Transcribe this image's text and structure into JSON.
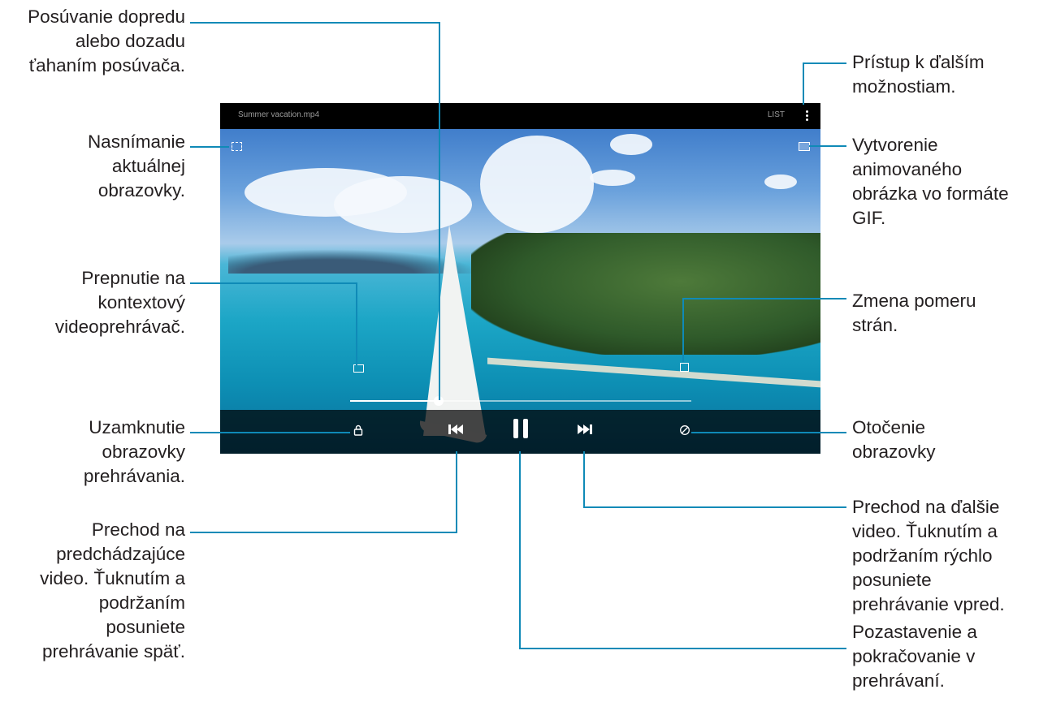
{
  "video": {
    "title": "Summer vacation.mp4",
    "top_right_text": "LIST",
    "progress": 0.26
  },
  "callouts": {
    "seek": "Posúvanie dopredu\nalebo dozadu\nťahaním posúvača.",
    "capture": "Nasnímanie\naktuálnej\nobrazovky.",
    "popup": "Prepnutie na\nkontextový\nvideoprehrávač.",
    "lock": "Uzamknutie\nobrazovky\nprehrávania.",
    "previous": "Prechod na\npredchádzajúce\nvideo. Ťuknutím a\npodržaním\nposuniete\nprehrávanie späť.",
    "more": "Prístup k ďalším\nmožnostiam.",
    "gif": "Vytvorenie\nanimovaného\nobrázka vo formáte\nGIF.",
    "ratio": "Zmena pomeru\nstrán.",
    "rotate": "Otočenie\nobrazovky",
    "next": "Prechod na ďalšie\nvideo. Ťuknutím a\npodržaním rýchlo\nposuniete\nprehrávanie vpred.",
    "pause": "Pozastavenie a\npokračovanie v\nprehrávaní."
  },
  "icons": {
    "capture": "capture-icon",
    "gif": "gif-icon",
    "popup": "popup-player-icon",
    "ratio": "ratio-icon",
    "lock": "lock-icon",
    "previous": "previous-icon",
    "pause": "pause-icon",
    "next": "next-icon",
    "rotate": "rotate-icon",
    "more": "more-options-icon"
  },
  "colors": {
    "leader": "#0f8ab7",
    "text": "#231f20"
  }
}
